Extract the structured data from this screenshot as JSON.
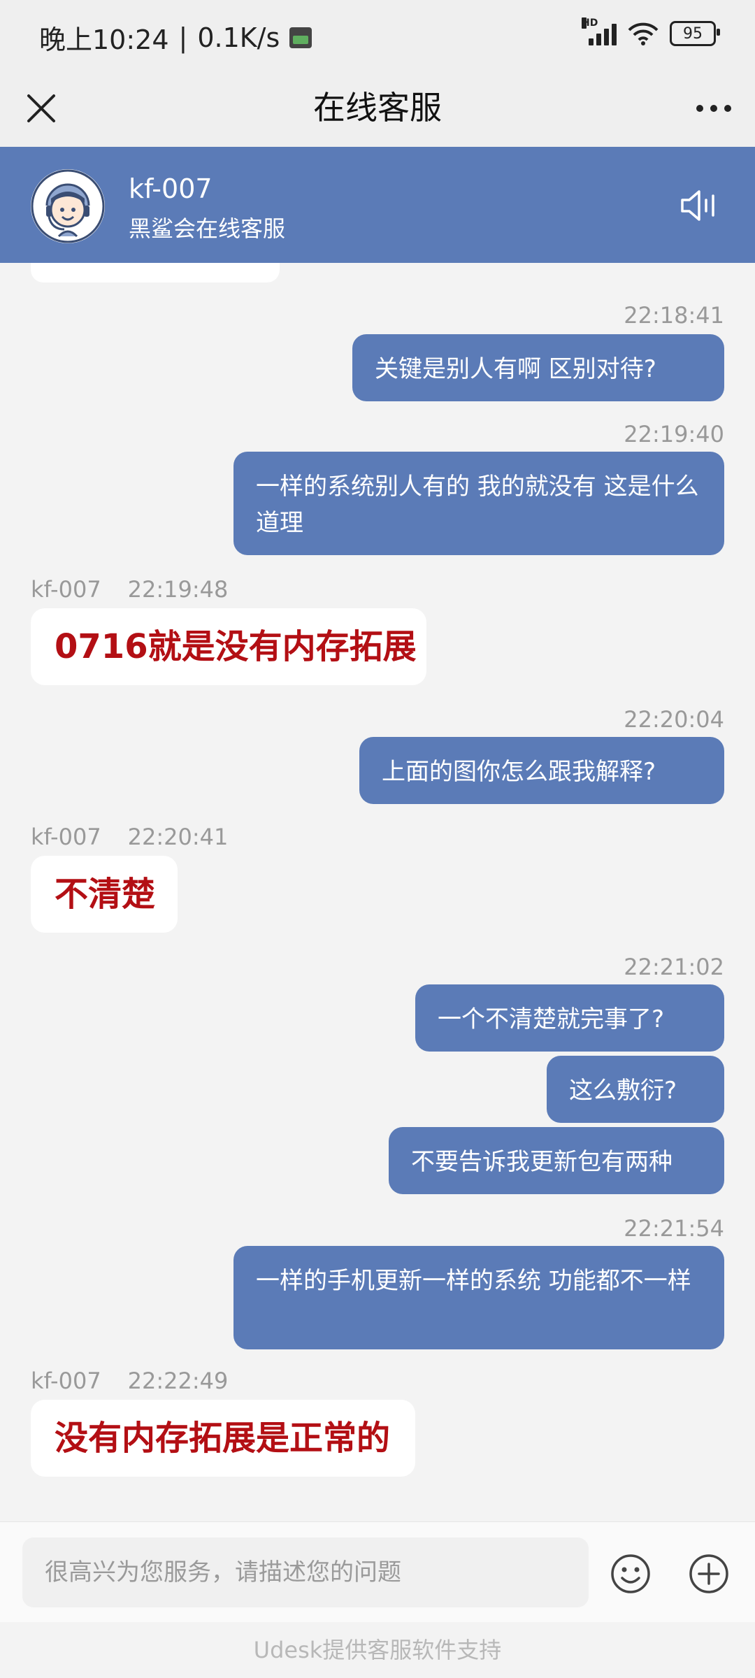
{
  "status_bar": {
    "time": "晚上10:24",
    "net_speed": "0.1K/s",
    "separator": "|",
    "hd_label": "HD",
    "battery": "95"
  },
  "nav": {
    "title": "在线客服",
    "close_icon": "close-icon",
    "more_icon": "more-icon"
  },
  "agent": {
    "name": "kf-007",
    "subtitle": "黑鲨会在线客服",
    "sound_icon": "speaker-icon"
  },
  "messages": [
    {
      "time": "22:18:41",
      "text": "关键是别人有啊 区别对待?"
    },
    {
      "time": "22:19:40",
      "text": "一样的系统别人有的 我的就没有 这是什么道理"
    },
    {
      "sender": "kf-007",
      "time": "22:19:48",
      "text": "0716就是没有内存拓展"
    },
    {
      "time": "22:20:04",
      "text": "上面的图你怎么跟我解释?"
    },
    {
      "sender": "kf-007",
      "time": "22:20:41",
      "text": "不清楚"
    },
    {
      "time": "22:21:02",
      "text": "一个不清楚就完事了?"
    },
    {
      "text": "这么敷衍?"
    },
    {
      "text": "不要告诉我更新包有两种"
    },
    {
      "time": "22:21:54",
      "text": "一样的手机更新一样的系统 功能都不一样"
    },
    {
      "sender": "kf-007",
      "time": "22:22:49",
      "text": "没有内存拓展是正常的"
    }
  ],
  "input": {
    "placeholder": "很高兴为您服务，请描述您的问题",
    "emoji_icon": "emoji-icon",
    "plus_icon": "plus-icon"
  },
  "footer": "Udesk提供客服软件支持",
  "colors": {
    "brand": "#5b7bb7",
    "agent_text": "#b30f14",
    "background": "#f3f3f3"
  }
}
